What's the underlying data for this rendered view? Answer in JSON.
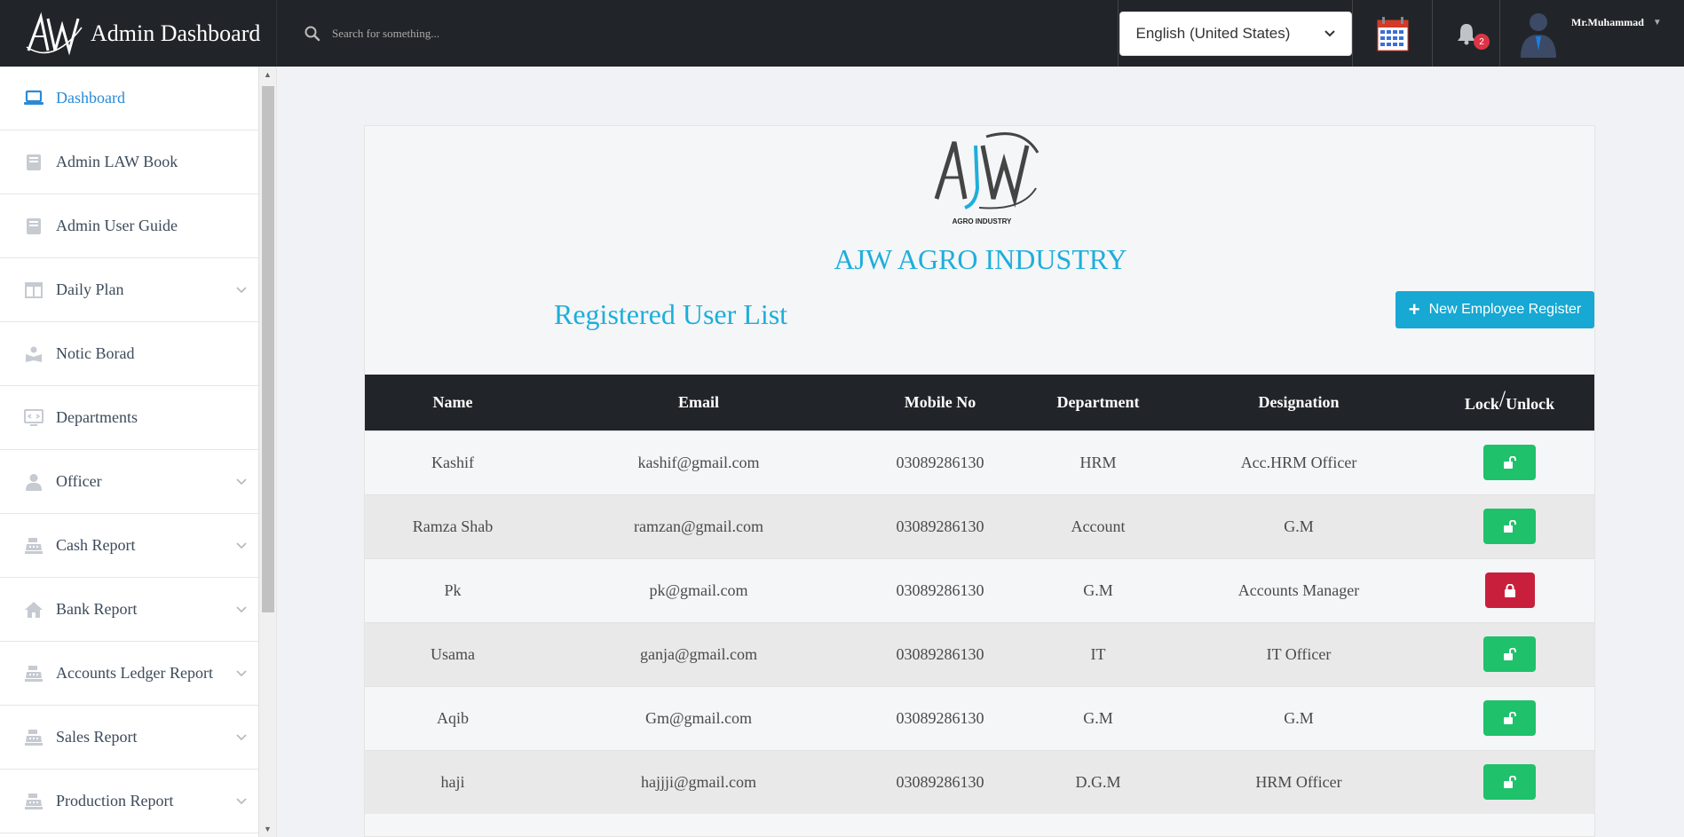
{
  "brand": {
    "logo_text": "AW",
    "title": "Admin Dashboard"
  },
  "search": {
    "placeholder": "Search for something..."
  },
  "language": {
    "selected": "English (United States)"
  },
  "notifications": {
    "count": "2"
  },
  "user": {
    "name": "Mr.Muhammad"
  },
  "sidebar": {
    "items": [
      {
        "label": "Dashboard",
        "icon": "laptop-icon",
        "active": true,
        "expandable": false
      },
      {
        "label": "Admin LAW Book",
        "icon": "book-icon",
        "active": false,
        "expandable": false
      },
      {
        "label": "Admin User Guide",
        "icon": "book-icon",
        "active": false,
        "expandable": false
      },
      {
        "label": "Daily Plan",
        "icon": "columns-icon",
        "active": false,
        "expandable": true
      },
      {
        "label": "Notic Borad",
        "icon": "reader-icon",
        "active": false,
        "expandable": false
      },
      {
        "label": "Departments",
        "icon": "monitor-code-icon",
        "active": false,
        "expandable": false
      },
      {
        "label": "Officer",
        "icon": "user-icon",
        "active": false,
        "expandable": true
      },
      {
        "label": "Cash Report",
        "icon": "cash-register-icon",
        "active": false,
        "expandable": true
      },
      {
        "label": "Bank Report",
        "icon": "home-icon",
        "active": false,
        "expandable": true
      },
      {
        "label": "Accounts Ledger Report",
        "icon": "cash-register-icon",
        "active": false,
        "expandable": true
      },
      {
        "label": "Sales Report",
        "icon": "cash-register-icon",
        "active": false,
        "expandable": true
      },
      {
        "label": "Production Report",
        "icon": "cash-register-icon",
        "active": false,
        "expandable": true
      }
    ]
  },
  "main": {
    "company_logo_text": "AJW",
    "company_logo_sub": "AGRO INDUSTRY",
    "company_name": "AJW AGRO INDUSTRY",
    "list_title": "Registered User List",
    "new_button_label": "New Employee Register",
    "table": {
      "headers": {
        "name": "Name",
        "email": "Email",
        "mobile": "Mobile No",
        "department": "Department",
        "designation": "Designation",
        "lock_a": "Lock",
        "lock_slash": "/",
        "lock_b": "Unlock"
      },
      "rows": [
        {
          "name": "Kashif",
          "email": "kashif@gmail.com",
          "mobile": "03089286130",
          "department": "HRM",
          "designation": "Acc.HRM Officer",
          "locked": false
        },
        {
          "name": "Ramza Shab",
          "email": "ramzan@gmail.com",
          "mobile": "03089286130",
          "department": "Account",
          "designation": "G.M",
          "locked": false
        },
        {
          "name": "Pk",
          "email": "pk@gmail.com",
          "mobile": "03089286130",
          "department": "G.M",
          "designation": "Accounts Manager",
          "locked": true
        },
        {
          "name": "Usama",
          "email": "ganja@gmail.com",
          "mobile": "03089286130",
          "department": "IT",
          "designation": "IT Officer",
          "locked": false
        },
        {
          "name": "Aqib",
          "email": "Gm@gmail.com",
          "mobile": "03089286130",
          "department": "G.M",
          "designation": "G.M",
          "locked": false
        },
        {
          "name": "haji",
          "email": "hajjji@gmail.com",
          "mobile": "03089286130",
          "department": "D.G.M",
          "designation": "HRM Officer",
          "locked": false
        }
      ]
    }
  },
  "colors": {
    "topbar": "#212529",
    "accent": "#1eaedb",
    "unlocked": "#1fc16b",
    "locked": "#c8203c",
    "active_nav": "#2a8ad6"
  }
}
